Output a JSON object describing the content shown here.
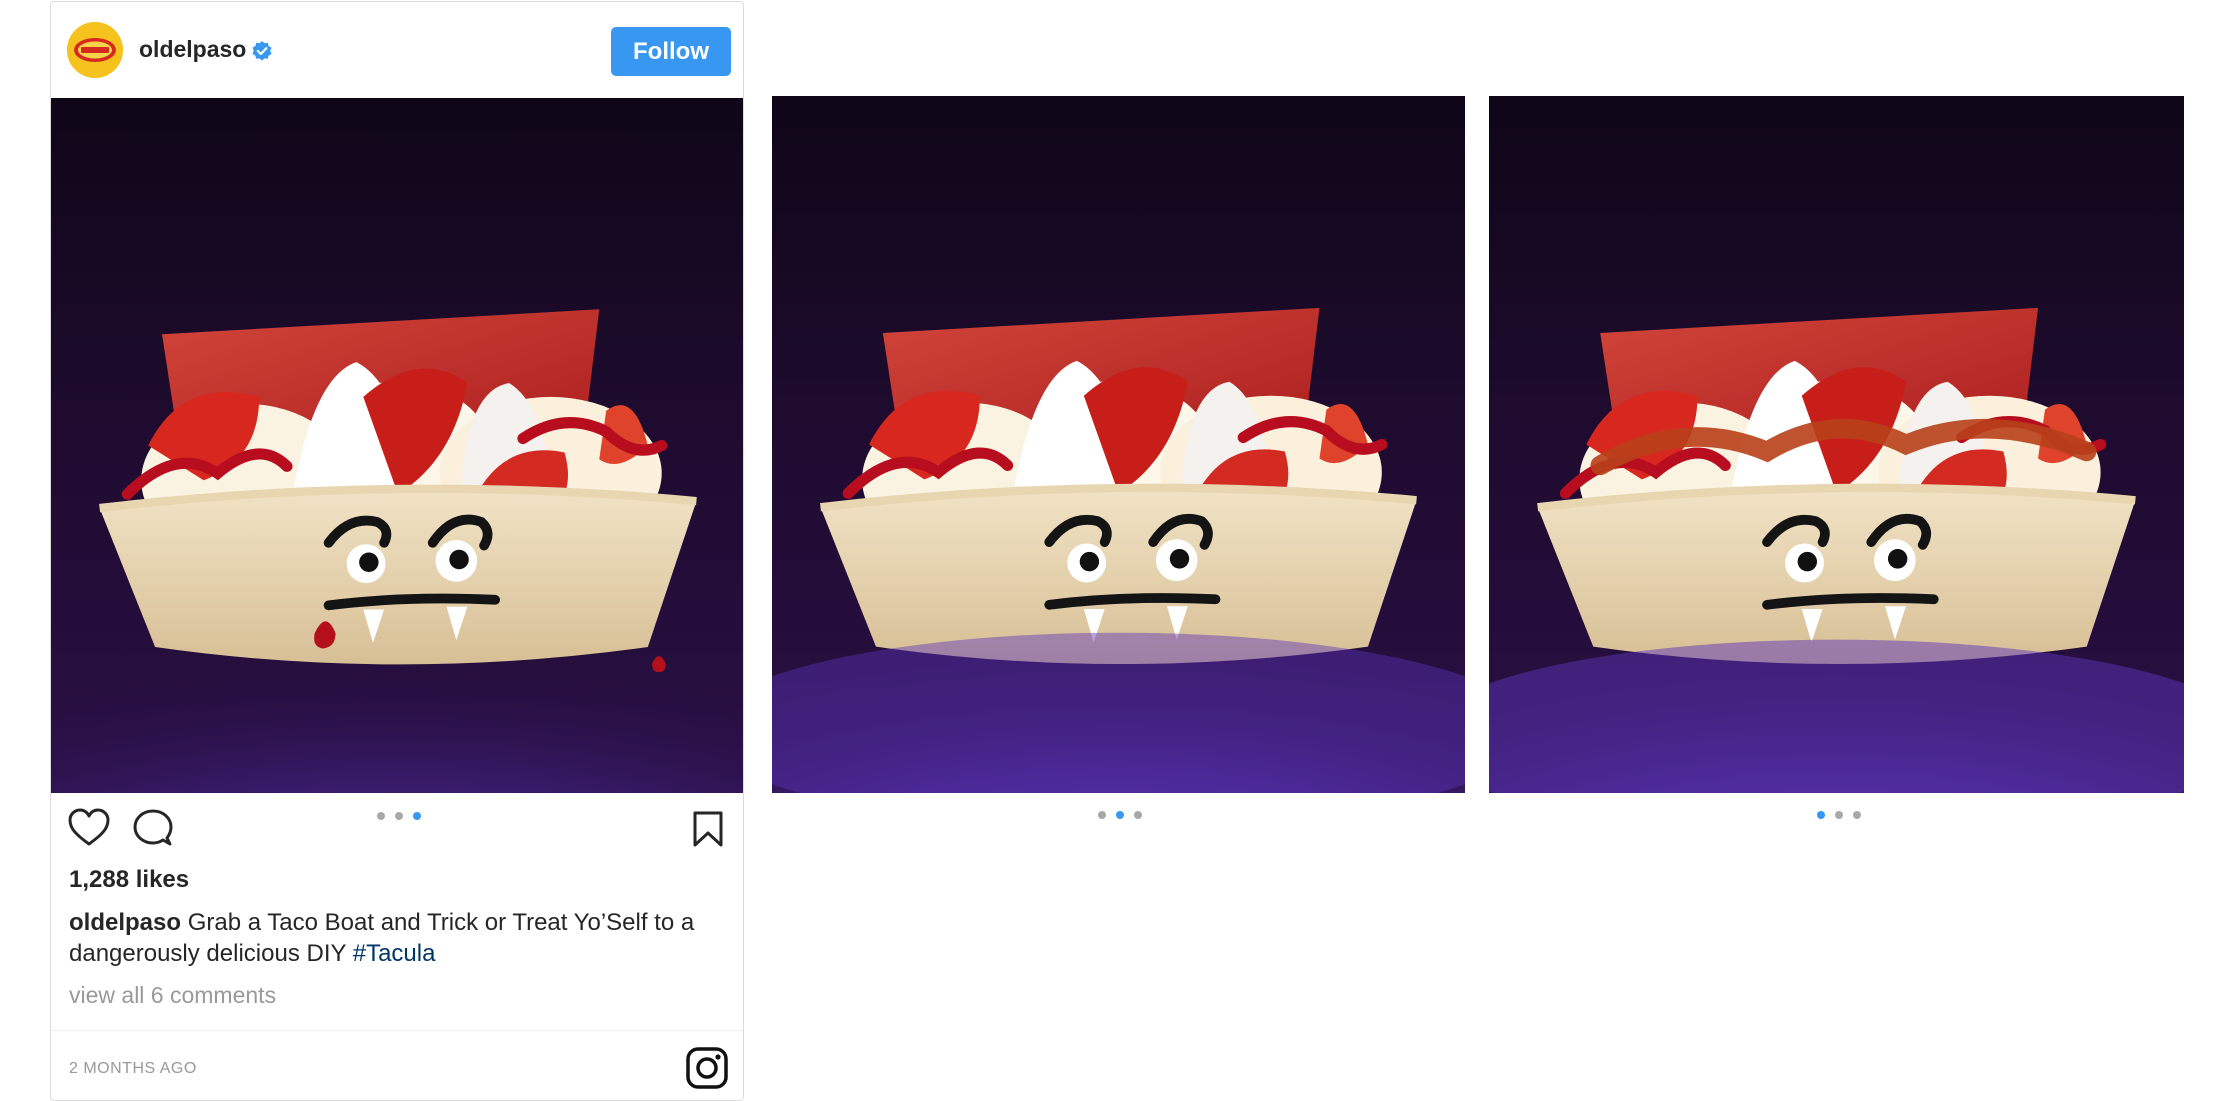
{
  "post": {
    "account": {
      "username": "oldelpaso",
      "verified": true,
      "avatar_icon": "old-el-paso-logo"
    },
    "follow_label": "Follow",
    "likes": "1,288 likes",
    "caption": {
      "username": "oldelpaso",
      "text": "Grab a Taco Boat and Trick or Treat Yo’Self to a dangerously delicious DIY",
      "hashtag": "#Tacula"
    },
    "view_comments": "view all 6 comments",
    "timestamp": "2 MONTHS AGO",
    "carousel": {
      "total": 3,
      "active_index": 3
    },
    "icons": [
      "heart-icon",
      "comment-icon",
      "bookmark-icon",
      "instagram-icon",
      "verified-icon"
    ]
  },
  "previews": [
    {
      "carousel": {
        "total": 3,
        "active_index": 2
      }
    },
    {
      "carousel": {
        "total": 3,
        "active_index": 1
      }
    }
  ],
  "colors": {
    "follow_button": "#3897f0",
    "active_dot": "#3897f0",
    "inactive_dot": "#a8a8a8",
    "hashtag": "#003569",
    "background_purple": "#2a0f45",
    "fog_purple": "#5b34b8"
  }
}
